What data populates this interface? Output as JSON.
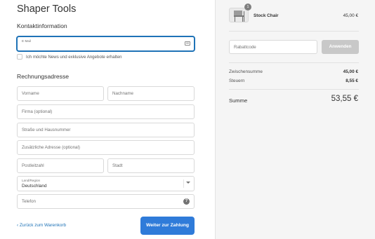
{
  "store": {
    "title": "Shaper Tools"
  },
  "contact": {
    "title": "Kontaktinformation",
    "email_label": "E-Mail",
    "newsletter_label": "Ich möchte News und exklusive Angebote erhalten"
  },
  "billing": {
    "title": "Rechnungsadresse",
    "first_name_placeholder": "Vorname",
    "last_name_placeholder": "Nachname",
    "company_placeholder": "Firma (optional)",
    "street_placeholder": "Straße und Hausnummer",
    "address2_placeholder": "Zusätzliche Adresse (optional)",
    "zip_placeholder": "Postleitzahl",
    "city_placeholder": "Stadt",
    "country_label": "Land/Region",
    "country_value": "Deutschland",
    "phone_placeholder": "Telefon"
  },
  "footer": {
    "back_label": "‹ Zurück zum Warenkorb",
    "continue_label": "Weiter zur Zahlung"
  },
  "summary": {
    "product": {
      "name": "Stock Chair",
      "price": "45,00 €",
      "quantity": "1"
    },
    "discount_placeholder": "Rabattcode",
    "apply_label": "Anwenden",
    "subtotal_label": "Zwischensumme",
    "subtotal_value": "45,00 €",
    "tax_label": "Steuern",
    "tax_value": "8,55 €",
    "total_label": "Summe",
    "total_value": "53,55 €"
  },
  "icons": {
    "email": "card-icon",
    "country": "chevron-down-icon",
    "phone": "help-icon"
  },
  "colors": {
    "accent": "#2f7bd9",
    "link": "#1f73b7",
    "sidebar_bg": "#f5f5f5",
    "disabled_button": "#c8c8c8"
  }
}
